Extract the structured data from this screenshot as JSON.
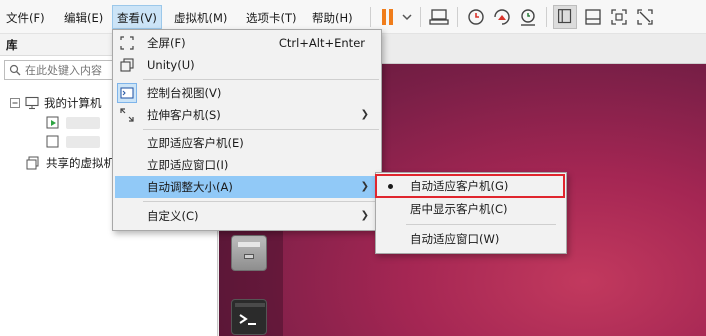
{
  "menubar": {
    "items": [
      {
        "label": "文件(F)"
      },
      {
        "label": "编辑(E)"
      },
      {
        "label": "查看(V)"
      },
      {
        "label": "虚拟机(M)"
      },
      {
        "label": "选项卡(T)"
      },
      {
        "label": "帮助(H)"
      }
    ]
  },
  "toolbar": {
    "icons": [
      "pause-icon",
      "dropdown-arrow-icon",
      "send-ctrl-alt-del-icon",
      "snapshot-icon",
      "revert-snapshot-icon",
      "snapshot-manager-icon",
      "library-view-icon",
      "thumbnail-bar-icon",
      "fullscreen-icon",
      "unity-icon"
    ],
    "accent_color": "#f07d1b"
  },
  "library": {
    "title": "库",
    "search_placeholder": "在此处键入内容",
    "tree": [
      {
        "label": "我的计算机"
      },
      {
        "label": "共享的虚拟机"
      }
    ]
  },
  "view_menu": {
    "items": [
      {
        "label": "全屏(F)",
        "shortcut": "Ctrl+Alt+Enter",
        "icon": "fullscreen-icon"
      },
      {
        "label": "Unity(U)",
        "icon": "unity-icon"
      },
      {
        "label": "控制台视图(V)",
        "icon": "console-view-icon",
        "checked": true
      },
      {
        "label": "拉伸客户机(S)",
        "icon": "stretch-icon",
        "has_submenu": true
      },
      {
        "label": "立即适应客户机(E)"
      },
      {
        "label": "立即适应窗口(I)"
      },
      {
        "label": "自动调整大小(A)",
        "has_submenu": true,
        "highlighted": true
      },
      {
        "label": "自定义(C)",
        "has_submenu": true
      }
    ]
  },
  "autosize_submenu": {
    "items": [
      {
        "label": "自动适应客户机(G)",
        "selected": true,
        "outlined": true
      },
      {
        "label": "居中显示客户机(C)"
      },
      {
        "label": "自动适应窗口(W)"
      }
    ],
    "outline_color": "#e0262e"
  },
  "guest": {
    "background_color": "#a42653",
    "launcher_icons": [
      "files-icon",
      "terminal-icon"
    ]
  }
}
